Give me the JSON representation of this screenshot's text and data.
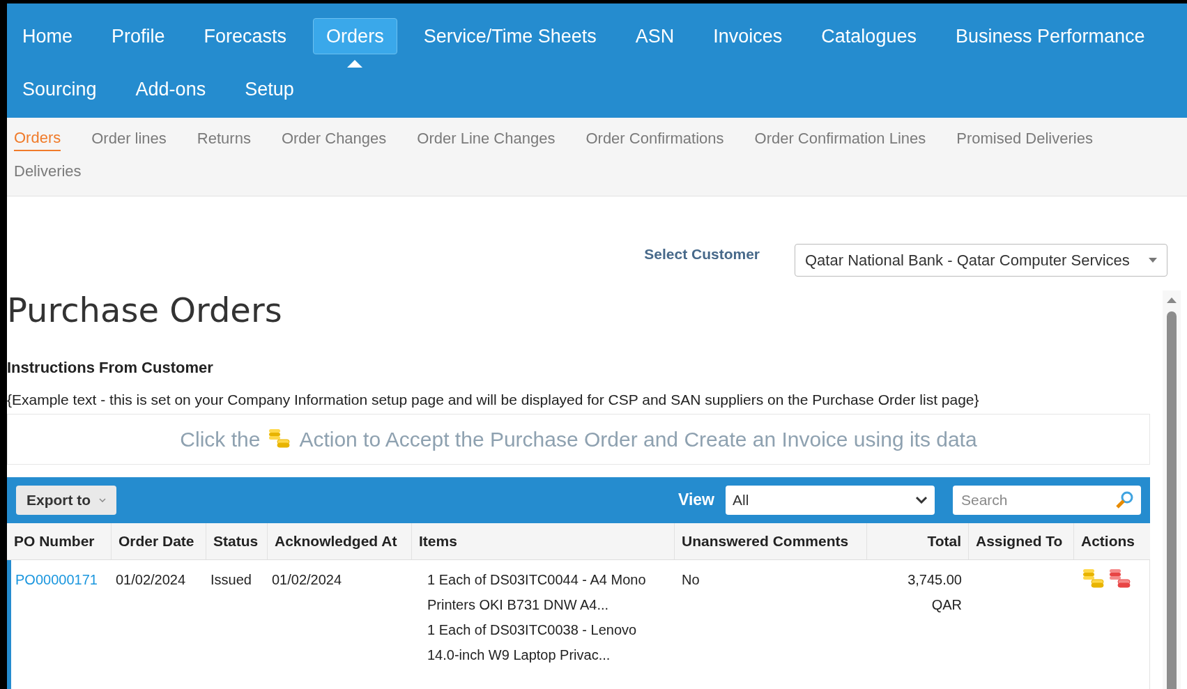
{
  "main_nav": {
    "rows": [
      [
        {
          "label": "Home",
          "selected": false
        },
        {
          "label": "Profile",
          "selected": false
        },
        {
          "label": "Forecasts",
          "selected": false
        },
        {
          "label": "Orders",
          "selected": true
        },
        {
          "label": "Service/Time Sheets",
          "selected": false
        },
        {
          "label": "ASN",
          "selected": false
        },
        {
          "label": "Invoices",
          "selected": false
        },
        {
          "label": "Catalogues",
          "selected": false
        },
        {
          "label": "Business Performance",
          "selected": false
        }
      ],
      [
        {
          "label": "Sourcing",
          "selected": false
        },
        {
          "label": "Add-ons",
          "selected": false
        },
        {
          "label": "Setup",
          "selected": false
        }
      ]
    ]
  },
  "sub_nav": {
    "rows": [
      [
        {
          "label": "Orders",
          "selected": true
        },
        {
          "label": "Order lines",
          "selected": false
        },
        {
          "label": "Returns",
          "selected": false
        },
        {
          "label": "Order Changes",
          "selected": false
        },
        {
          "label": "Order Line Changes",
          "selected": false
        },
        {
          "label": "Order Confirmations",
          "selected": false
        },
        {
          "label": "Order Confirmation Lines",
          "selected": false
        },
        {
          "label": "Promised Deliveries",
          "selected": false
        }
      ],
      [
        {
          "label": "Deliveries",
          "selected": false
        }
      ]
    ]
  },
  "customer": {
    "label": "Select Customer",
    "value": "Qatar National Bank - Qatar Computer Services"
  },
  "title": "Purchase Orders",
  "instructions": {
    "heading": "Instructions From Customer",
    "text": "{Example text - this is set on your Company Information setup page and will be displayed for CSP and SAN suppliers on the Purchase Order list page}"
  },
  "hint": {
    "before": "Click the",
    "after": "Action to Accept the Purchase Order and Create an Invoice using its data"
  },
  "toolbar": {
    "export": "Export to",
    "view_label": "View",
    "view_value": "All",
    "search_placeholder": "Search"
  },
  "table": {
    "columns": [
      "PO Number",
      "Order Date",
      "Status",
      "Acknowledged At",
      "Items",
      "Unanswered Comments",
      "Total",
      "Assigned To",
      "Actions"
    ],
    "rows": [
      {
        "po_number": "PO00000171",
        "order_date": "01/02/2024",
        "status": "Issued",
        "acknowledged_at": "01/02/2024",
        "items": [
          "1 Each of DS03ITC0044 - A4 Mono Printers OKI B731 DNW A4...",
          "1 Each of DS03ITC0038 - Lenovo 14.0-inch W9 Laptop Privac..."
        ],
        "unanswered_comments": "No",
        "total": "3,745.00",
        "currency": "QAR",
        "actions": [
          {
            "kind": "accept"
          },
          {
            "kind": "reject"
          }
        ]
      }
    ]
  }
}
